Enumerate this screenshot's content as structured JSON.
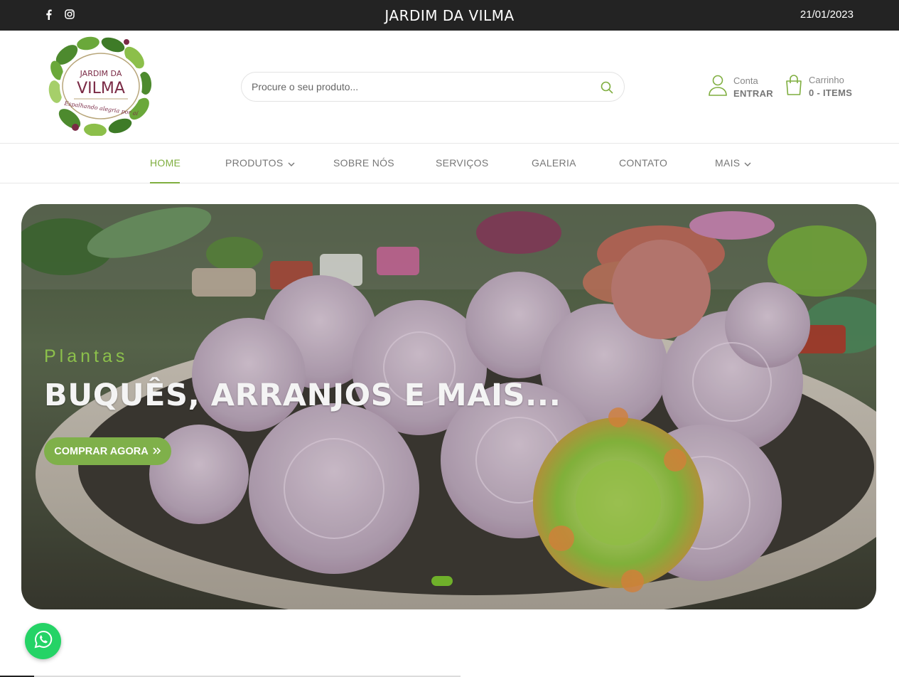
{
  "topbar": {
    "social_icons": [
      "facebook-icon",
      "instagram-icon"
    ],
    "brand": "JARDIM DA VILMA",
    "date": "21/01/2023"
  },
  "header": {
    "logo": {
      "line1": "JARDIM DA",
      "line2": "VILMA",
      "tagline": "Espalhando alegria por aí"
    },
    "search": {
      "placeholder": "Procure o seu produto...",
      "icon": "search-icon"
    },
    "account": {
      "label": "Conta",
      "action": "ENTRAR",
      "icon": "user-icon"
    },
    "cart": {
      "label": "Carrinho",
      "count": "0 - ITEMS",
      "icon": "shopping-bag-icon"
    }
  },
  "nav": {
    "items": [
      {
        "label": "HOME",
        "active": true
      },
      {
        "label": "PRODUTOS",
        "dropdown": true
      },
      {
        "label": "SOBRE NÓS"
      },
      {
        "label": "SERVIÇOS"
      },
      {
        "label": "GALERIA"
      },
      {
        "label": "CONTATO"
      },
      {
        "label": "MAIS",
        "dropdown": true
      }
    ]
  },
  "hero": {
    "kicker": "Plantas",
    "headline": "BUQUÊS, ARRANJOS E MAIS...",
    "cta": "COMPRAR AGORA",
    "slides": 1,
    "active_slide": 1
  },
  "whatsapp": {
    "icon": "whatsapp-icon"
  },
  "colors": {
    "accent": "#7fae3f",
    "topbar": "#232323",
    "cta": "#7fb04a",
    "whatsapp": "#25d366"
  }
}
